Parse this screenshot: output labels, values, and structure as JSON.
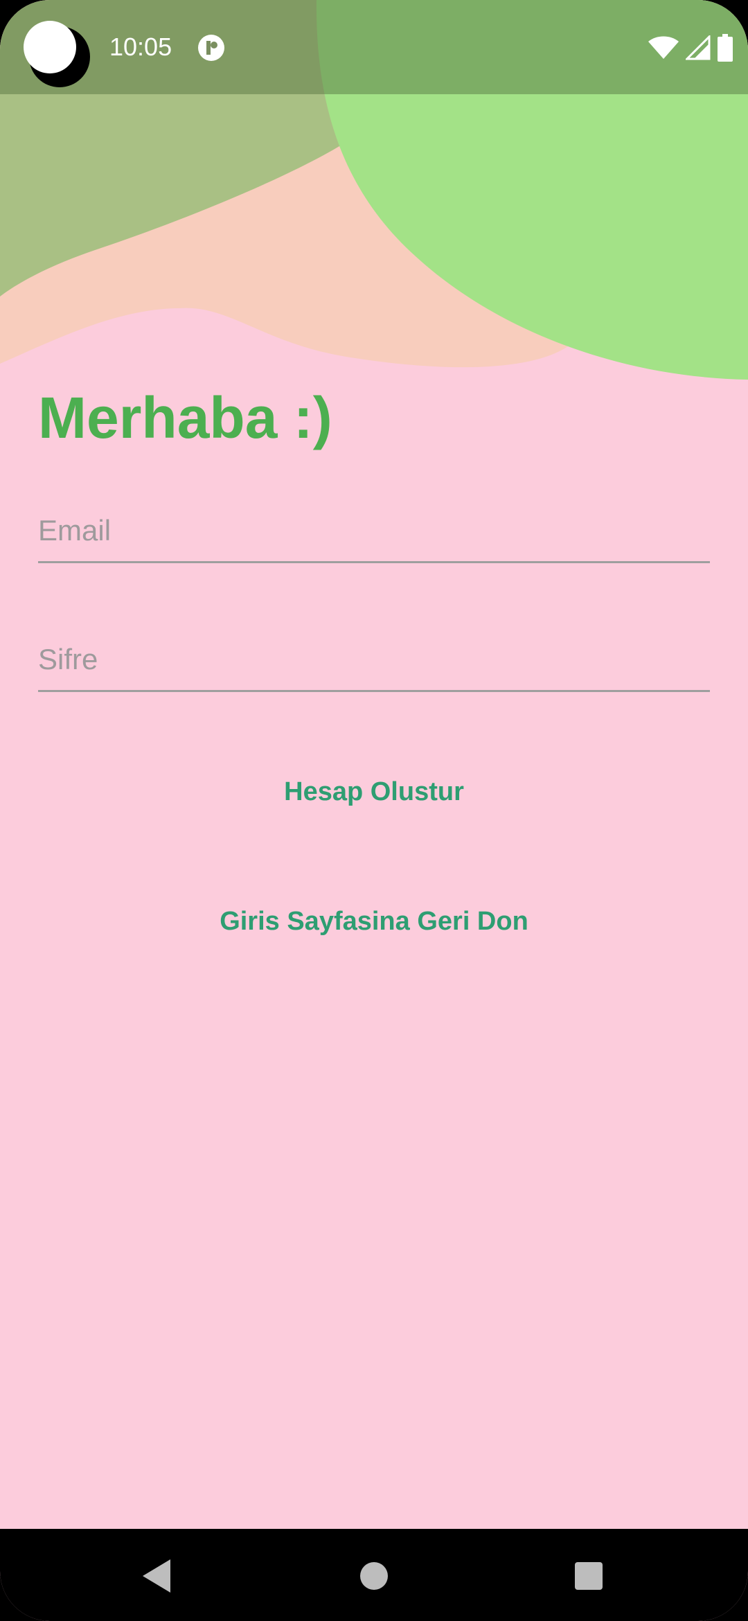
{
  "status_bar": {
    "time": "10:05",
    "icons": [
      "wifi-icon",
      "cellular-signal-icon",
      "battery-icon"
    ]
  },
  "screen": {
    "title": "Merhaba :)",
    "email_field": {
      "placeholder": "Email",
      "value": ""
    },
    "password_field": {
      "placeholder": "Sifre",
      "value": ""
    },
    "create_account_label": "Hesap Olustur",
    "back_to_login_label": "Giris Sayfasina Geri Don"
  },
  "navigation_bar": {
    "buttons": [
      "back-icon",
      "home-icon",
      "recents-icon"
    ]
  },
  "colors": {
    "background": "#FCCCDC",
    "accent_green": "#4CAF50",
    "button_text": "#2E9E72",
    "blob_light_green": "#A3E287",
    "blob_olive": "#A9C084",
    "blob_peach": "#F8CDBD"
  }
}
